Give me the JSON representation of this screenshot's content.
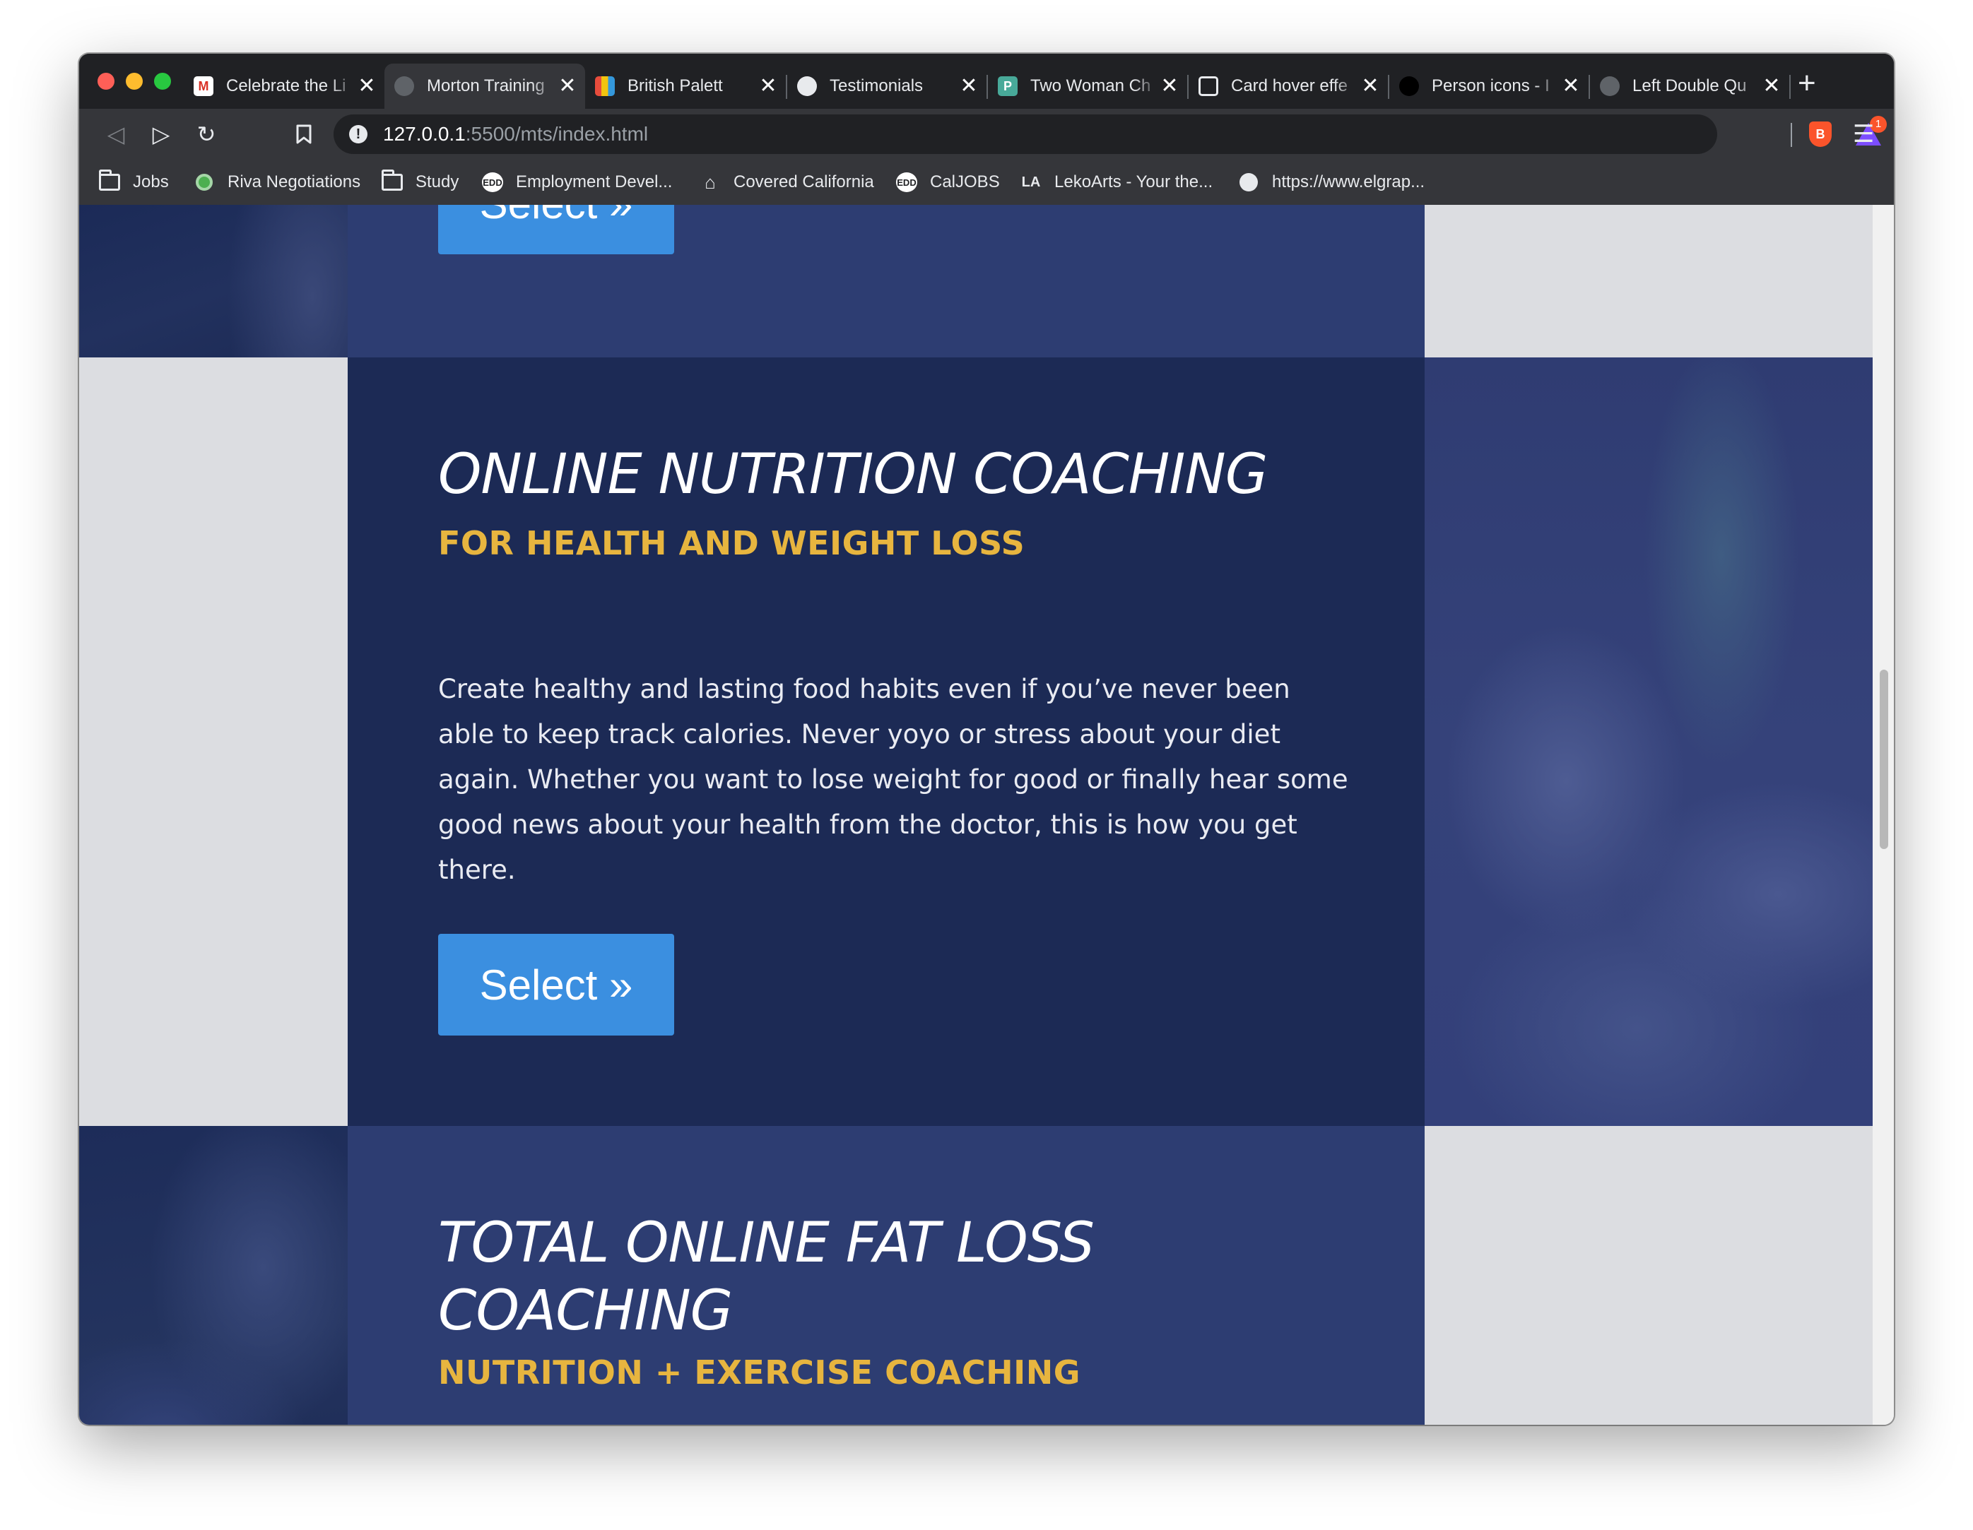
{
  "browser": {
    "tabs": [
      {
        "title": "Celebrate the Li",
        "favicon": "gmail-icon"
      },
      {
        "title": "Morton Training",
        "favicon": "globe-icon"
      },
      {
        "title": "British Palett",
        "favicon": "palette-icon"
      },
      {
        "title": "Testimonials",
        "favicon": "globe-icon"
      },
      {
        "title": "Two Woman Ch",
        "favicon": "p-icon"
      },
      {
        "title": "Card hover effe",
        "favicon": "codepen-icon"
      },
      {
        "title": "Person icons - I",
        "favicon": "noun-project-icon"
      },
      {
        "title": "Left Double Qu",
        "favicon": "globe-icon"
      }
    ],
    "close_glyph": "✕",
    "new_tab_glyph": "+",
    "url": {
      "host": "127.0.0.1",
      "path": ":5500/mts/index.html"
    },
    "rewards_count": "1",
    "bookmarks": [
      {
        "label": "Jobs",
        "icon": "folder-icon"
      },
      {
        "label": "Riva Negotiations",
        "icon": "riva-icon"
      },
      {
        "label": "Study",
        "icon": "folder-icon"
      },
      {
        "label": "Employment Devel...",
        "icon": "edd-icon"
      },
      {
        "label": "Covered California",
        "icon": "covered-california-icon"
      },
      {
        "label": "CalJOBS",
        "icon": "edd-icon"
      },
      {
        "label": "LekoArts - Your the...",
        "icon": "lekoarts-icon"
      },
      {
        "label": "https://www.elgrap...",
        "icon": "globe-icon"
      }
    ]
  },
  "page": {
    "services": [
      {
        "select_label": "Select »"
      },
      {
        "title": "ONLINE NUTRITION COACHING",
        "subtitle": "FOR HEALTH AND WEIGHT LOSS",
        "description": "Create healthy and lasting food habits even if you’ve never been able to keep track calories. Never yoyo or stress about your diet again. Whether you want to lose weight for good or finally hear some good news about your health from the doctor, this is how you get there.",
        "select_label": "Select »"
      },
      {
        "title_line1": "TOTAL ONLINE FAT LOSS",
        "title_line2": "COACHING",
        "subtitle": "NUTRITION + EXERCISE COACHING"
      }
    ],
    "colors": {
      "panel_dark": "#1c2a55",
      "panel_light": "#2d3d72",
      "accent_gold": "#e7b53f",
      "button_blue": "#3b8fe0",
      "background_gray": "#dcdde1"
    }
  }
}
